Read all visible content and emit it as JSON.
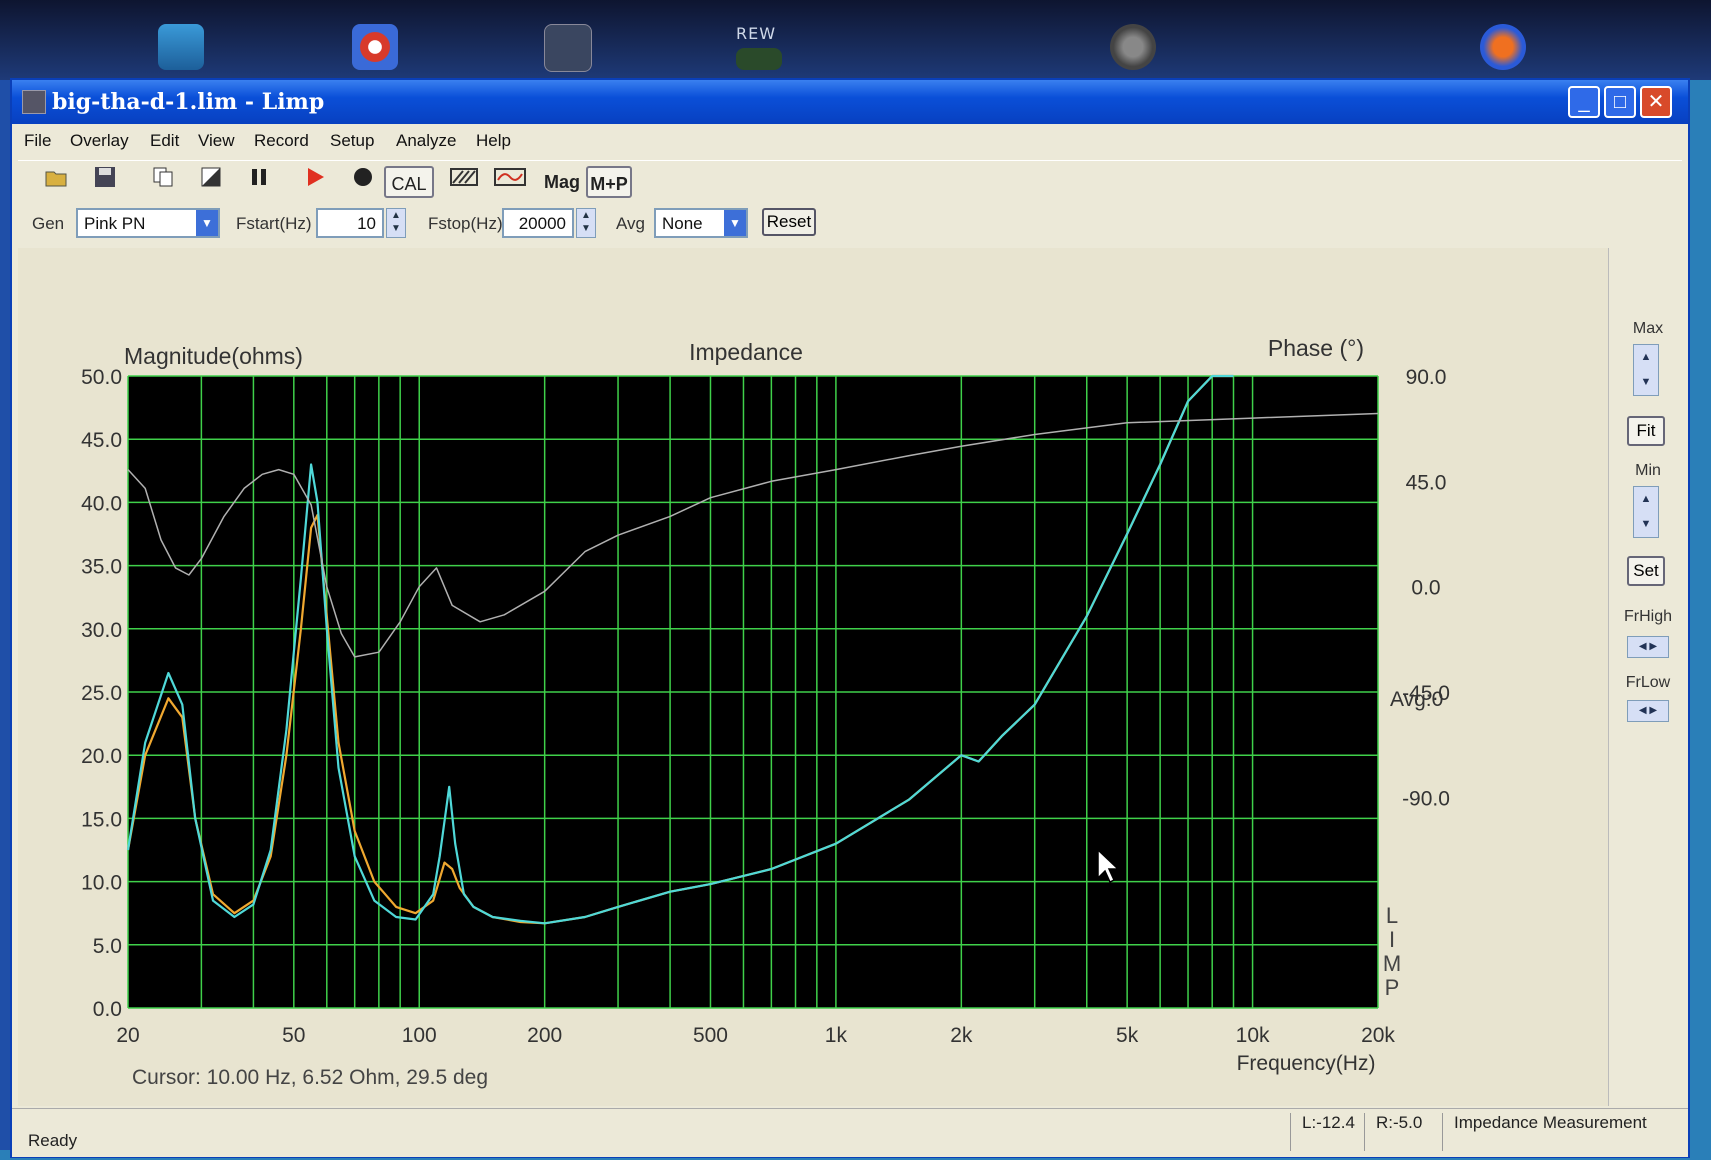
{
  "desktop": {
    "rew_label": "REW",
    "icons": [
      "recycle-bin-icon",
      "update-icon",
      "graph-app-icon",
      "rew-app-icon",
      "speaker-app-icon",
      "fire-app-icon"
    ]
  },
  "window": {
    "title": "big-tha-d-1.lim - Limp",
    "controls": {
      "minimize": "_",
      "maximize": "□",
      "close": "✕"
    }
  },
  "menu": [
    "File",
    "Overlay",
    "Edit",
    "View",
    "Record",
    "Setup",
    "Analyze",
    "Help"
  ],
  "toolbar": {
    "cal": "CAL",
    "mag": "Mag",
    "mp": "M+P"
  },
  "gen": {
    "gen_label": "Gen",
    "gen_value": "Pink PN",
    "fstart_label": "Fstart(Hz)",
    "fstart_value": "10",
    "fstop_label": "Fstop(Hz)",
    "fstop_value": "20000",
    "avg_label": "Avg",
    "avg_value": "None",
    "reset_label": "Reset"
  },
  "right_panel": {
    "max_label": "Max",
    "fit_label": "Fit",
    "min_label": "Min",
    "set_label": "Set",
    "frhigh_label": "FrHigh",
    "frlow_label": "FrLow"
  },
  "chart_data": {
    "type": "line",
    "title": "Impedance",
    "ylabel": "Magnitude(ohms)",
    "y2label": "Phase (°)",
    "xlabel": "Frequency(Hz)",
    "x_scale": "log",
    "xlim": [
      20,
      20000
    ],
    "ylim": [
      0,
      50
    ],
    "y2lim": [
      -180,
      90
    ],
    "x_ticks": [
      20,
      50,
      100,
      200,
      500,
      1000,
      2000,
      5000,
      10000,
      20000
    ],
    "x_tick_labels": [
      "20",
      "50",
      "100",
      "200",
      "500",
      "1k",
      "2k",
      "5k",
      "10k",
      "20k"
    ],
    "y_ticks": [
      "0.0",
      "5.0",
      "10.0",
      "15.0",
      "20.0",
      "25.0",
      "30.0",
      "35.0",
      "40.0",
      "45.0",
      "50.0"
    ],
    "y2_ticks": [
      "90.0",
      "45.0",
      "0.0",
      "-45.0",
      "-90.0"
    ],
    "avg_label": "Avg:0",
    "watermark": "LIMP",
    "grid": true,
    "background": "#000000",
    "grid_color": "#3fd04a",
    "series": [
      {
        "color": "#f0a830",
        "x": [
          20,
          22,
          25,
          27,
          29,
          32,
          36,
          40,
          44,
          48,
          52,
          55,
          57,
          60,
          64,
          70,
          78,
          88,
          98,
          108,
          115,
          120,
          125,
          135,
          150,
          175,
          200,
          250,
          300,
          400,
          500,
          700,
          1000,
          1500,
          2000,
          2200,
          2500,
          3000,
          4000,
          5000,
          6000,
          7000,
          8000,
          9000
        ],
        "y": [
          12.5,
          20,
          24.5,
          23,
          15,
          9,
          7.5,
          8.5,
          12,
          20,
          30,
          38,
          39,
          31,
          21,
          14,
          10,
          8,
          7.5,
          8.5,
          11.5,
          11,
          9.5,
          8,
          7.2,
          6.8,
          6.7,
          7.2,
          8,
          9.2,
          9.8,
          11,
          13,
          16.5,
          20,
          19.5,
          21.5,
          24,
          31,
          37.5,
          43,
          48,
          51,
          55
        ]
      },
      {
        "color": "#4fd8d8",
        "x": [
          20,
          22,
          25,
          27,
          29,
          32,
          36,
          40,
          44,
          48,
          52,
          55,
          57,
          60,
          64,
          70,
          78,
          88,
          98,
          108,
          112,
          118,
          122,
          128,
          135,
          150,
          175,
          200,
          250,
          300,
          400,
          500,
          700,
          1000,
          1500,
          2000,
          2200,
          2500,
          3000,
          4000,
          5000,
          6000,
          7000,
          8000,
          9000
        ],
        "y": [
          12.5,
          21,
          26.5,
          24,
          15,
          8.5,
          7.2,
          8.2,
          12.5,
          22,
          34,
          43,
          40,
          30,
          19,
          12,
          8.5,
          7.2,
          7,
          9,
          12,
          17.5,
          13,
          9,
          8,
          7.2,
          6.9,
          6.7,
          7.2,
          8,
          9.2,
          9.8,
          11,
          13,
          16.5,
          20,
          19.5,
          21.5,
          24,
          31,
          37.5,
          43,
          48,
          51,
          55
        ]
      },
      {
        "color": "#b0b0b0",
        "name": "phase",
        "axis": "y2",
        "x": [
          20,
          22,
          24,
          26,
          28,
          30,
          34,
          38,
          42,
          46,
          50,
          55,
          60,
          65,
          70,
          80,
          90,
          100,
          110,
          120,
          140,
          160,
          200,
          250,
          300,
          400,
          500,
          700,
          1000,
          1500,
          2000,
          3000,
          5000,
          10000,
          20000
        ],
        "y": [
          50,
          42,
          20,
          8,
          5,
          12,
          30,
          42,
          48,
          50,
          48,
          35,
          0,
          -20,
          -30,
          -28,
          -15,
          0,
          8,
          -8,
          -15,
          -12,
          -2,
          15,
          22,
          30,
          38,
          45,
          50,
          56,
          60,
          65,
          70,
          72,
          74
        ]
      }
    ]
  },
  "cursor": {
    "readout": "Cursor: 10.00 Hz, 6.52 Ohm, 29.5 deg"
  },
  "status": {
    "ready": "Ready",
    "left_level": "L:-12.4",
    "right_level": "R:-5.0",
    "mode": "Impedance Measurement"
  }
}
